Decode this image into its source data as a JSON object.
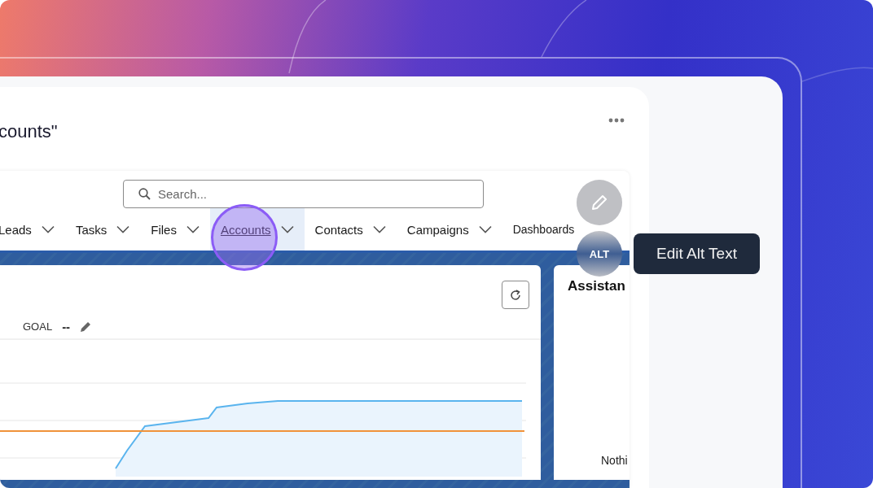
{
  "card": {
    "title": "counts\""
  },
  "search": {
    "placeholder": "Search..."
  },
  "nav": [
    {
      "label": "Leads",
      "selected": false
    },
    {
      "label": "Tasks",
      "selected": false
    },
    {
      "label": "Files",
      "selected": false
    },
    {
      "label": "Accounts",
      "selected": true
    },
    {
      "label": "Contacts",
      "selected": false
    },
    {
      "label": "Campaigns",
      "selected": false
    },
    {
      "label": "Dashboards",
      "selected": false
    }
  ],
  "chart_card": {
    "goal_label": "GOAL",
    "goal_value": "--"
  },
  "assistant": {
    "title": "Assistan",
    "message": "Nothi"
  },
  "overlay": {
    "alt_badge": "ALT",
    "tooltip": "Edit Alt Text"
  }
}
